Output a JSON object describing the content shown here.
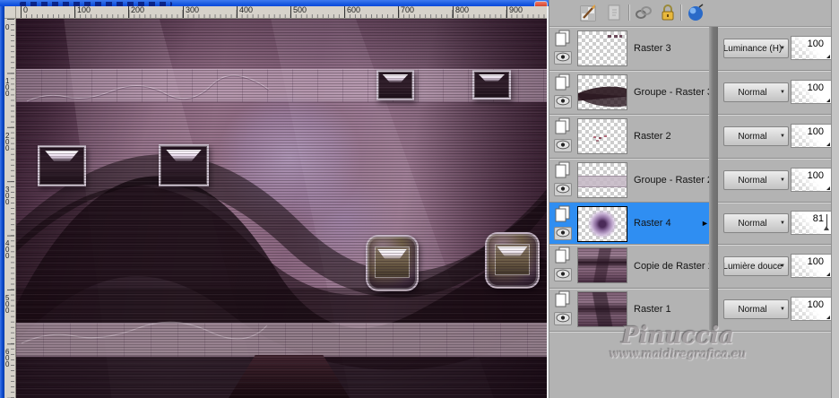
{
  "rulers": {
    "horizontal": [
      "0",
      "100",
      "200",
      "300",
      "400",
      "500",
      "600",
      "700",
      "800",
      "900"
    ],
    "vertical": [
      "0",
      "100",
      "200",
      "300",
      "400",
      "500",
      "600"
    ]
  },
  "layers_panel": {
    "toolbar_icons": [
      "brush-edit",
      "new-layer-disabled",
      "chain-link",
      "padlock",
      "sphere"
    ],
    "rows": [
      {
        "name": "Raster 3",
        "blend": "Luminance (H)",
        "opacity": "100",
        "selected": false
      },
      {
        "name": "Groupe - Raster 3",
        "blend": "Normal",
        "opacity": "100",
        "selected": false
      },
      {
        "name": "Raster 2",
        "blend": "Normal",
        "opacity": "100",
        "selected": false
      },
      {
        "name": "Groupe - Raster 2",
        "blend": "Normal",
        "opacity": "100",
        "selected": false
      },
      {
        "name": "Raster 4",
        "blend": "Normal",
        "opacity": "81",
        "selected": true
      },
      {
        "name": "Copie de Raster 1",
        "blend": "Lumière douce",
        "opacity": "100",
        "selected": false
      },
      {
        "name": "Raster 1",
        "blend": "Normal",
        "opacity": "100",
        "selected": false
      }
    ],
    "selection_color": "#2f8ef2"
  },
  "icons": {
    "dropdown_arrow": "▼",
    "selected_row_arrow": "►"
  },
  "watermark": {
    "line1": "Pinuccia",
    "line2": "www.maidiregrafica.eu"
  },
  "colors": {
    "panel_bg": "#b3b3b3",
    "titlebar_blue": "#0d4fd9",
    "ruler_bg": "#d6d2ca",
    "canvas_base": "#8a6a80"
  }
}
